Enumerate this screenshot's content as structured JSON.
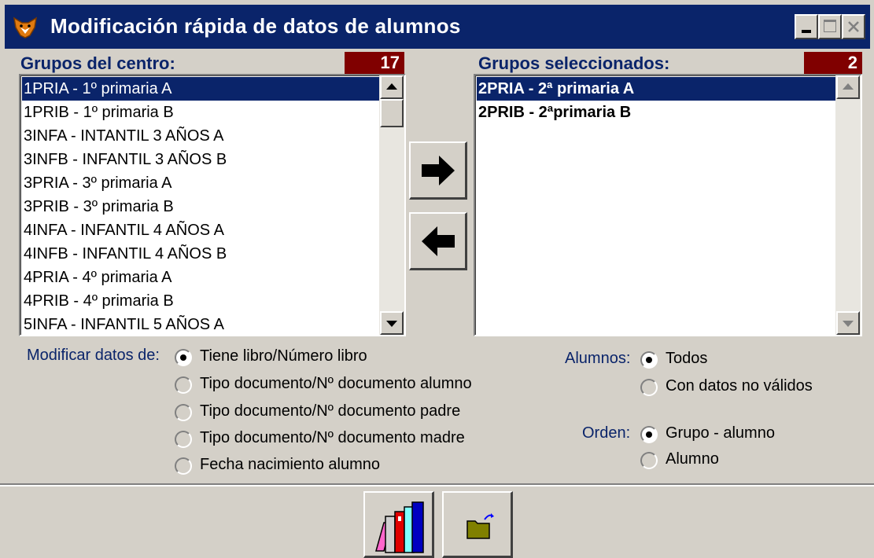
{
  "window": {
    "title": "Modificación rápida de datos de alumnos",
    "icon": "fox-app-icon"
  },
  "left_list": {
    "label": "Grupos del centro:",
    "count": "17",
    "items": [
      "1PRIA - 1º primaria A",
      "1PRIB - 1º primaria B",
      "3INFA - INTANTIL 3 AÑOS A",
      "3INFB - INFANTIL 3 AÑOS B",
      "3PRIA - 3º primaria A",
      "3PRIB - 3º primaria B",
      "4INFA - INFANTIL 4 AÑOS A",
      "4INFB - INFANTIL 4 AÑOS B",
      "4PRIA - 4º primaria A",
      "4PRIB - 4º primaria B",
      "5INFA - INFANTIL 5 AÑOS A"
    ],
    "selected_index": 0
  },
  "right_list": {
    "label": "Grupos seleccionados:",
    "count": "2",
    "items": [
      "2PRIA - 2ª primaria A",
      "2PRIB - 2ªprimaria B"
    ],
    "selected_index": 0
  },
  "transfer_buttons": {
    "add_icon": "arrow-right-icon",
    "remove_icon": "arrow-left-icon"
  },
  "modify_group": {
    "label": "Modificar datos de:",
    "options": [
      {
        "label": "Tiene libro/Número libro",
        "checked": true
      },
      {
        "label": "Tipo documento/Nº documento alumno",
        "checked": false
      },
      {
        "label": "Tipo documento/Nº documento padre",
        "checked": false
      },
      {
        "label": "Tipo documento/Nº documento madre",
        "checked": false
      },
      {
        "label": "Fecha nacimiento alumno",
        "checked": false
      }
    ]
  },
  "students_group": {
    "label": "Alumnos:",
    "options": [
      {
        "label": "Todos",
        "checked": true
      },
      {
        "label": "Con datos no válidos",
        "checked": false
      }
    ]
  },
  "order_group": {
    "label": "Orden:",
    "options": [
      {
        "label": "Grupo - alumno",
        "checked": true
      },
      {
        "label": "Alumno",
        "checked": false
      }
    ]
  },
  "bottom_buttons": {
    "books_icon": "books-icon",
    "exit_icon": "exit-folder-icon"
  },
  "colors": {
    "titlebar": "#0a246a",
    "count_badge": "#800000",
    "face": "#d4d0c8"
  }
}
